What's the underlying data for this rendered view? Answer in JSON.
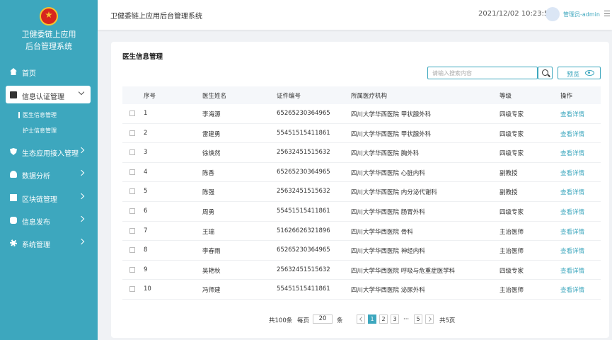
{
  "app": {
    "title_line1": "卫健委链上应用",
    "title_line2": "后台管理系统"
  },
  "sidebar": {
    "items": [
      {
        "label": "首页",
        "icon": "home-icon"
      },
      {
        "label": "信息认证管理",
        "icon": "document-icon",
        "expanded": true,
        "children": [
          {
            "label": "医生信息管理",
            "active": true
          },
          {
            "label": "护士信息管理"
          }
        ]
      },
      {
        "label": "生态应用接入管理",
        "icon": "shield-icon"
      },
      {
        "label": "数据分析",
        "icon": "user-icon"
      },
      {
        "label": "区块链管理",
        "icon": "block-icon"
      },
      {
        "label": "信息发布",
        "icon": "message-icon"
      },
      {
        "label": "系统管理",
        "icon": "gear-icon"
      }
    ]
  },
  "header": {
    "title": "卫健委链上应用后台管理系统",
    "datetime": "2021/12/02 10:23:57",
    "user": "管理员-admin"
  },
  "main": {
    "title": "医生信息管理",
    "search_placeholder": "请输入搜索内容",
    "search_value": "",
    "preview_label": "预览",
    "columns": [
      "序号",
      "医生姓名",
      "证件编号",
      "所属医疗机构",
      "等级",
      "操作"
    ],
    "rows": [
      {
        "no": "1",
        "name": "李海源",
        "id": "65265230364965",
        "org": "四川大学华西医院 甲状腺外科",
        "level": "四级专家",
        "action": "查看详情"
      },
      {
        "no": "2",
        "name": "雷建勇",
        "id": "55451515411861",
        "org": "四川大学华西医院 甲状腺外科",
        "level": "四级专家",
        "action": "查看详情"
      },
      {
        "no": "3",
        "name": "徐焕然",
        "id": "25632451515632",
        "org": "四川大学华西医院 胸外科",
        "level": "四级专家",
        "action": "查看详情"
      },
      {
        "no": "4",
        "name": "陈香",
        "id": "65265230364965",
        "org": "四川大学华西医院 心脏内科",
        "level": "副教授",
        "action": "查看详情"
      },
      {
        "no": "5",
        "name": "陈强",
        "id": "25632451515632",
        "org": "四川大学华西医院 内分泌代谢科",
        "level": "副教授",
        "action": "查看详情"
      },
      {
        "no": "6",
        "name": "周勇",
        "id": "55451515411861",
        "org": "四川大学华西医院 肠胃外科",
        "level": "四级专家",
        "action": "查看详情"
      },
      {
        "no": "7",
        "name": "王瑞",
        "id": "51626626321896",
        "org": "四川大学华西医院 骨科",
        "level": "主治医师",
        "action": "查看详情"
      },
      {
        "no": "8",
        "name": "李春雨",
        "id": "65265230364965",
        "org": "四川大学华西医院 神经内科",
        "level": "主治医师",
        "action": "查看详情"
      },
      {
        "no": "9",
        "name": "吴艳秋",
        "id": "25632451515632",
        "org": "四川大学华西医院 呼吸与危重症医学科",
        "level": "四级专家",
        "action": "查看详情"
      },
      {
        "no": "10",
        "name": "冯师建",
        "id": "55451515411861",
        "org": "四川大学华西医院 泌尿外科",
        "level": "主治医师",
        "action": "查看详情"
      }
    ]
  },
  "pagination": {
    "total": "共100条",
    "per_page_label": "每页",
    "per_page": "20",
    "per_page_unit": "条",
    "pages": [
      "1",
      "2",
      "3"
    ],
    "ellipsis": "···",
    "last_page": "5",
    "total_pages": "共5页",
    "current": "1"
  },
  "colors": {
    "sidebar_bg": "#3da7be",
    "accent": "#3da7be",
    "page_bg": "#f0f2f5"
  }
}
